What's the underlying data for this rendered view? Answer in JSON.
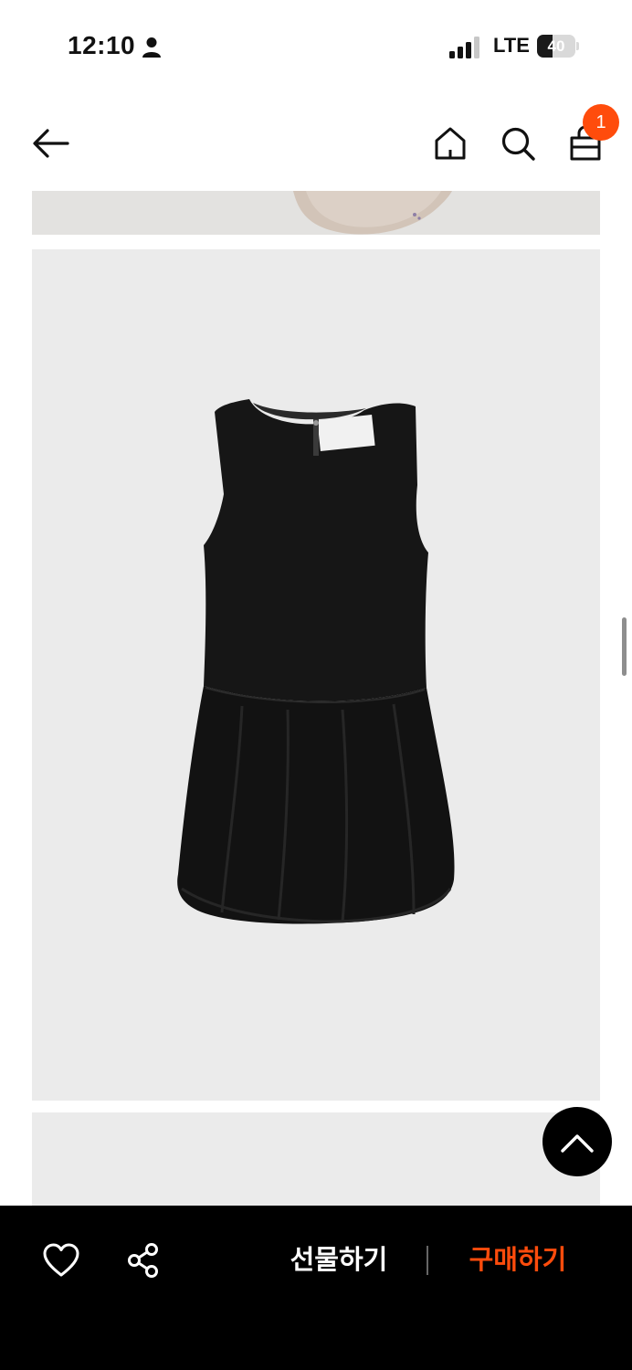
{
  "status_bar": {
    "time": "12:10",
    "network": "LTE",
    "battery_level": "40",
    "battery_fraction": 0.4,
    "icons": [
      "person-icon",
      "signal-icon",
      "battery-icon"
    ]
  },
  "header": {
    "icons": [
      "back-arrow-icon",
      "home-icon",
      "search-icon",
      "shopping-bag-icon"
    ],
    "cart_count": "1"
  },
  "product": {
    "image": "black-sleeveless-balloon-dress"
  },
  "bottom_bar": {
    "gift_label": "선물하기",
    "buy_label": "구매하기",
    "icons": [
      "heart-icon",
      "share-icon"
    ]
  },
  "colors": {
    "accent": "#ff4c0c",
    "bottom_bar_bg": "#000000",
    "image_bg": "#ebebeb"
  }
}
